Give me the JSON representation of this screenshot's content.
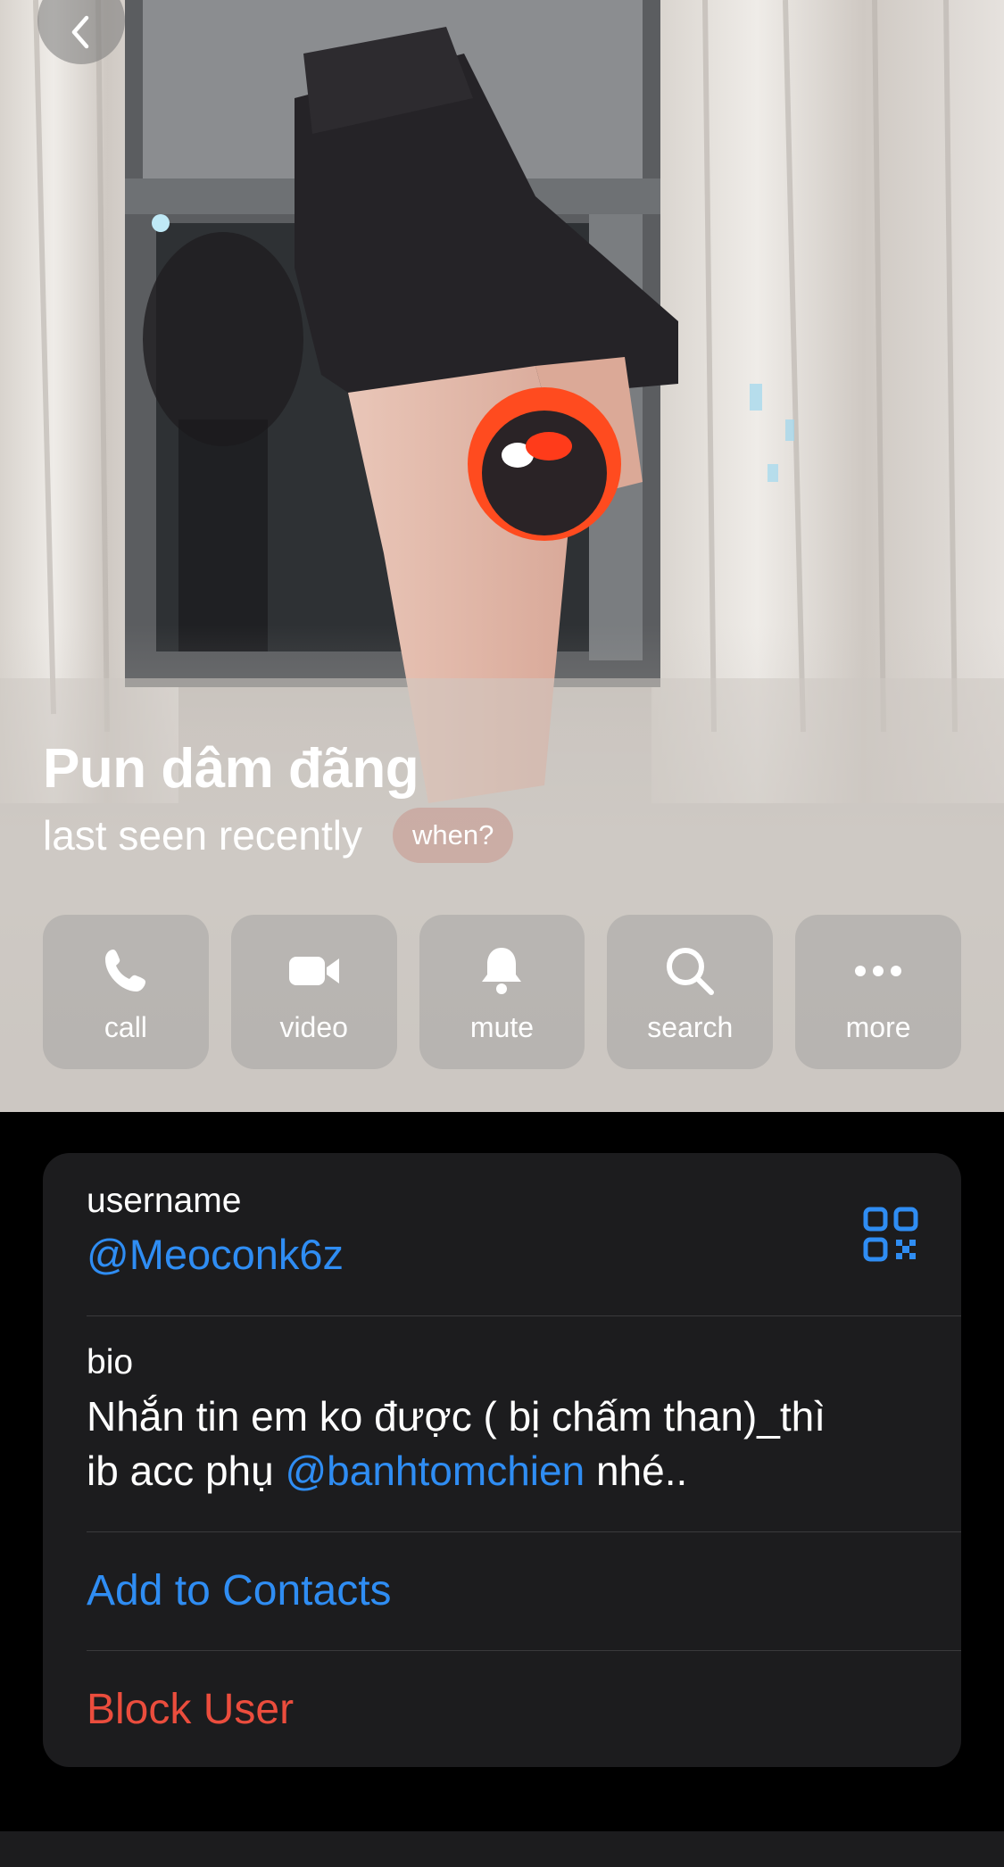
{
  "profile": {
    "name": "Pun dâm đãng",
    "status": "last seen recently",
    "when_label": "when?"
  },
  "actions": [
    {
      "label": "call",
      "icon": "phone-icon"
    },
    {
      "label": "video",
      "icon": "video-camera-icon"
    },
    {
      "label": "mute",
      "icon": "bell-icon"
    },
    {
      "label": "search",
      "icon": "search-icon"
    },
    {
      "label": "more",
      "icon": "more-dots-icon"
    }
  ],
  "info": {
    "username_label": "username",
    "username_value": "@Meoconk6z",
    "bio_label": "bio",
    "bio_line1": "Nhắn tin em ko được ( bị chấm than)_thì",
    "bio_line2_before": "ib acc phụ ",
    "bio_mention": "@banhtomchien",
    "bio_line2_after": " nhé..",
    "add_contacts": "Add to Contacts",
    "block_user": "Block User"
  },
  "colors": {
    "accent": "#2f8df3",
    "danger": "#eb4d3d",
    "card_bg": "#1c1c1e",
    "page_bg": "#000000"
  }
}
